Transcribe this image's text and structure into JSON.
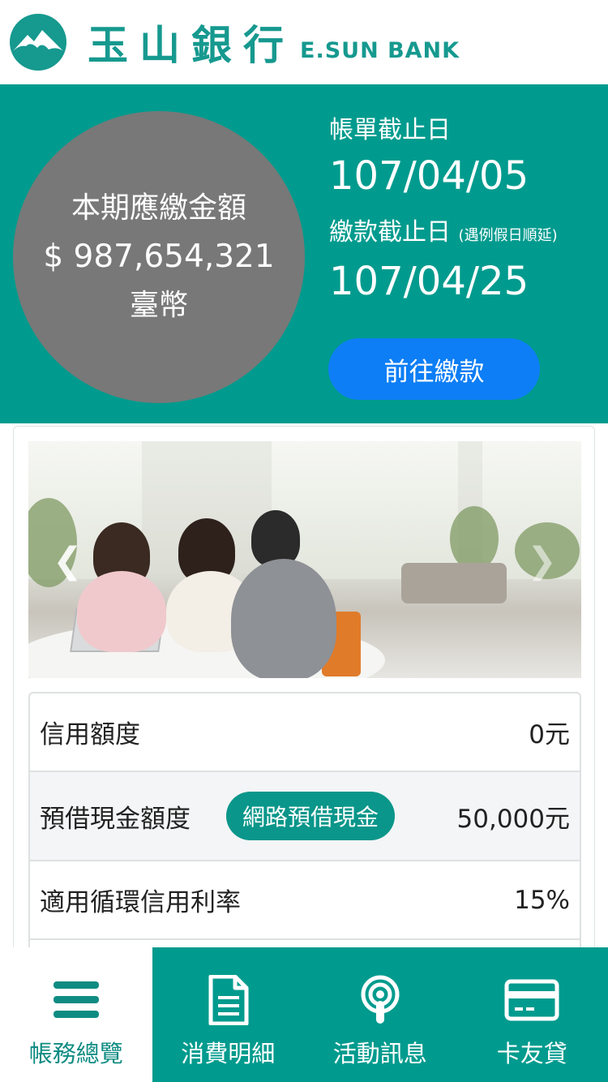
{
  "brand": {
    "name_cn": "玉山銀行",
    "name_en": "E.SUN BANK",
    "color": "#16998f"
  },
  "summary": {
    "amount_label": "本期應繳金額",
    "amount": "$ 987,654,321",
    "currency": "臺幣",
    "statement_date_label": "帳單截止日",
    "statement_date": "107/04/05",
    "payment_due_label": "繳款截止日",
    "payment_due_note": "(遇例假日順延)",
    "payment_due_date": "107/04/25",
    "pay_button": "前往繳款"
  },
  "carousel": {
    "prev_icon": "chevron-left-icon",
    "next_icon": "chevron-right-icon"
  },
  "details": {
    "rows": [
      {
        "label": "信用額度",
        "value": "0元"
      },
      {
        "label": "預借現金額度",
        "button": "網路預借現金",
        "value": "50,000元"
      },
      {
        "label": "適用循環信用利率",
        "value": "15%"
      }
    ]
  },
  "bottom_nav": {
    "items": [
      {
        "label": "帳務總覽",
        "icon": "menu-icon",
        "active": true
      },
      {
        "label": "消費明細",
        "icon": "document-icon",
        "active": false
      },
      {
        "label": "活動訊息",
        "icon": "broadcast-icon",
        "active": false
      },
      {
        "label": "卡友貸",
        "icon": "credit-card-icon",
        "active": false
      }
    ]
  },
  "colors": {
    "primary": "#009b8e",
    "pay_button": "#0d7ef5",
    "amount_circle": "#787878"
  }
}
